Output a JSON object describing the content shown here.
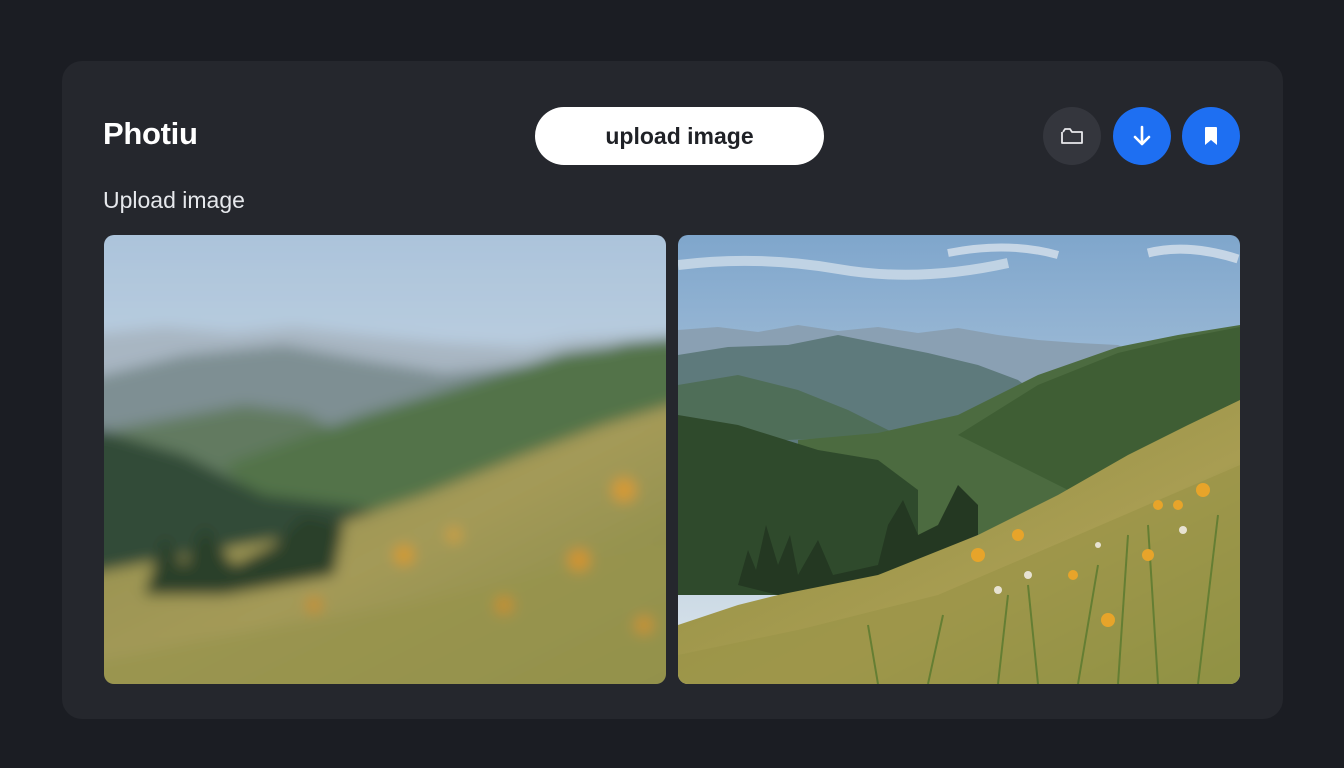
{
  "header": {
    "app_title": "Photiu",
    "upload_button_label": "upload image"
  },
  "toolbar": {
    "icons": [
      "folder-icon",
      "download-icon",
      "bookmark-icon"
    ]
  },
  "main": {
    "section_label": "Upload image",
    "images": [
      {
        "name": "blurred-mountain-meadow"
      },
      {
        "name": "sharp-mountain-meadow"
      }
    ]
  },
  "colors": {
    "background": "#1b1d23",
    "card": "#25272d",
    "accent": "#1e6ff2",
    "pill": "#ffffff"
  }
}
